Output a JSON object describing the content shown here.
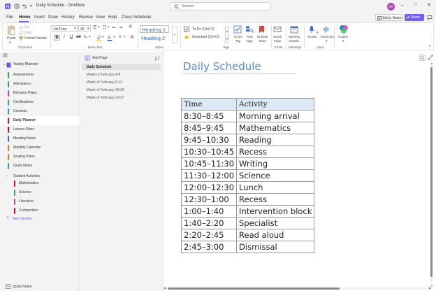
{
  "window": {
    "title": "Daily Schedule - OneNote",
    "search_placeholder": "Search",
    "avatar_initials": "AP"
  },
  "menu": {
    "items": [
      "File",
      "Home",
      "Insert",
      "Draw",
      "History",
      "Review",
      "View",
      "Help",
      "Class Notebook"
    ],
    "active": "Home",
    "sticky_notes": "Sticky Notes",
    "share": "Share"
  },
  "ribbon": {
    "clipboard": {
      "paste": "Paste",
      "cut": "Cut",
      "copy": "Copy",
      "format_painter": "Format Painter",
      "group": "Clipboard"
    },
    "basic_text": {
      "font": "Ink Free",
      "size": "20",
      "group": "Basic Text"
    },
    "styles": {
      "heading1": "Heading 1",
      "heading2": "Heading 2",
      "group": "Styles"
    },
    "tags": {
      "todo": "To Do (Ctrl+1)",
      "important": "Important (Ctrl+2)",
      "todo_tag": "To Do Tag",
      "find_tags": "Find Tags",
      "outlook_tasks": "Outlook Tasks",
      "group": "Tags"
    },
    "email": {
      "label": "Email Page",
      "group": "Email"
    },
    "meetings": {
      "label": "Meeting Details",
      "group": "Meetings"
    },
    "voice": {
      "dictate": "Dictate",
      "transcribe": "Transcribe",
      "group": "Voice"
    },
    "copilot": {
      "label": "Copilot"
    }
  },
  "notebook": {
    "name": "Yearly Planner"
  },
  "sections": [
    {
      "label": "Assessments",
      "color": "#3aa655"
    },
    {
      "label": "Attendance",
      "color": "#3aa655"
    },
    {
      "label": "Behavior Plans",
      "color": "#b04bb5"
    },
    {
      "label": "Certifications",
      "color": "#2e9bd6"
    },
    {
      "label": "Contacts",
      "color": "#2e9bd6"
    },
    {
      "label": "Daily Planner",
      "color": "#c8102e"
    },
    {
      "label": "Lesson Plans",
      "color": "#c8102e"
    },
    {
      "label": "Meeting Notes",
      "color": "#3a6fc4"
    },
    {
      "label": "Monthly Calendar",
      "color": "#e07b20"
    },
    {
      "label": "Seating Plans",
      "color": "#e07b20"
    },
    {
      "label": "Quick Notes",
      "color": "#2e9bd6"
    }
  ],
  "section_group": {
    "label": "Student Activities",
    "items": [
      {
        "label": "Mathematics",
        "color": "#c8102e"
      },
      {
        "label": "Science",
        "color": "#3aa655"
      },
      {
        "label": "Literature",
        "color": "#b04bb5"
      },
      {
        "label": "Composition",
        "color": "#c8102e"
      }
    ]
  },
  "new_section": "New Section",
  "quick_notes_footer": "Quick Notes",
  "pages": {
    "add_page": "Add Page",
    "items": [
      "Daily Schedule",
      "Week of February 4-8",
      "Week of February 9-13",
      "Week of February 16-20",
      "Week of February 23-27"
    ]
  },
  "page": {
    "title": "Daily Schedule",
    "headers": [
      "Time",
      "Activity"
    ],
    "rows": [
      [
        "8:30–8:45",
        "Morning arrival"
      ],
      [
        "8:45–9:45",
        "Mathematics"
      ],
      [
        "9:45–10:30",
        "Reading"
      ],
      [
        "10:30–10:45",
        "Recess"
      ],
      [
        "10:45–11:30",
        "Writing"
      ],
      [
        "11:30–12:00",
        "Science"
      ],
      [
        "12:00–12:30",
        "Lunch"
      ],
      [
        "12:30–1:00",
        "Recess"
      ],
      [
        "1:00–1:40",
        "Intervention block"
      ],
      [
        "1:40–2:20",
        "Specialist"
      ],
      [
        "2:20–2:45",
        "Read aloud"
      ],
      [
        "2:45–3:00",
        "Dismissal"
      ]
    ]
  },
  "colors": {
    "accent": "#7160e8",
    "title_blue": "#5b8bc0",
    "header_fill": "#dce8f4"
  }
}
